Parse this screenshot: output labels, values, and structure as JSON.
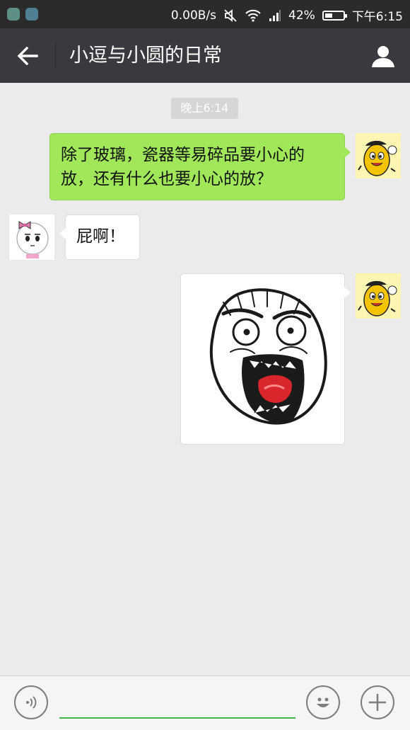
{
  "status_bar": {
    "net_speed": "0.00B/s",
    "battery_level": 0.42,
    "battery_text": "42%",
    "time": "下午6:15"
  },
  "header": {
    "title": "小逗与小圆的日常",
    "back_icon": "arrow-left-icon",
    "profile_icon": "person-icon"
  },
  "chat": {
    "time_label": "晚上6:14",
    "messages": [
      {
        "sender": "me",
        "text": "除了玻璃，瓷器等易碎品要小心的放，还有什么也要小心的放？"
      },
      {
        "sender": "other",
        "text": "屁啊！"
      },
      {
        "sender": "me",
        "sticker": "rage-face-sticker"
      }
    ]
  },
  "input_bar": {
    "voice_icon": "voice-icon",
    "text_value": "",
    "emoji_icon": "emoji-icon",
    "plus_icon": "plus-icon"
  },
  "colors": {
    "header": "#393a3f",
    "status_bar": "#2b2b2b",
    "chat_bg": "#ebebeb",
    "my_bubble": "#a0e75a",
    "input_underline": "#44b549"
  }
}
